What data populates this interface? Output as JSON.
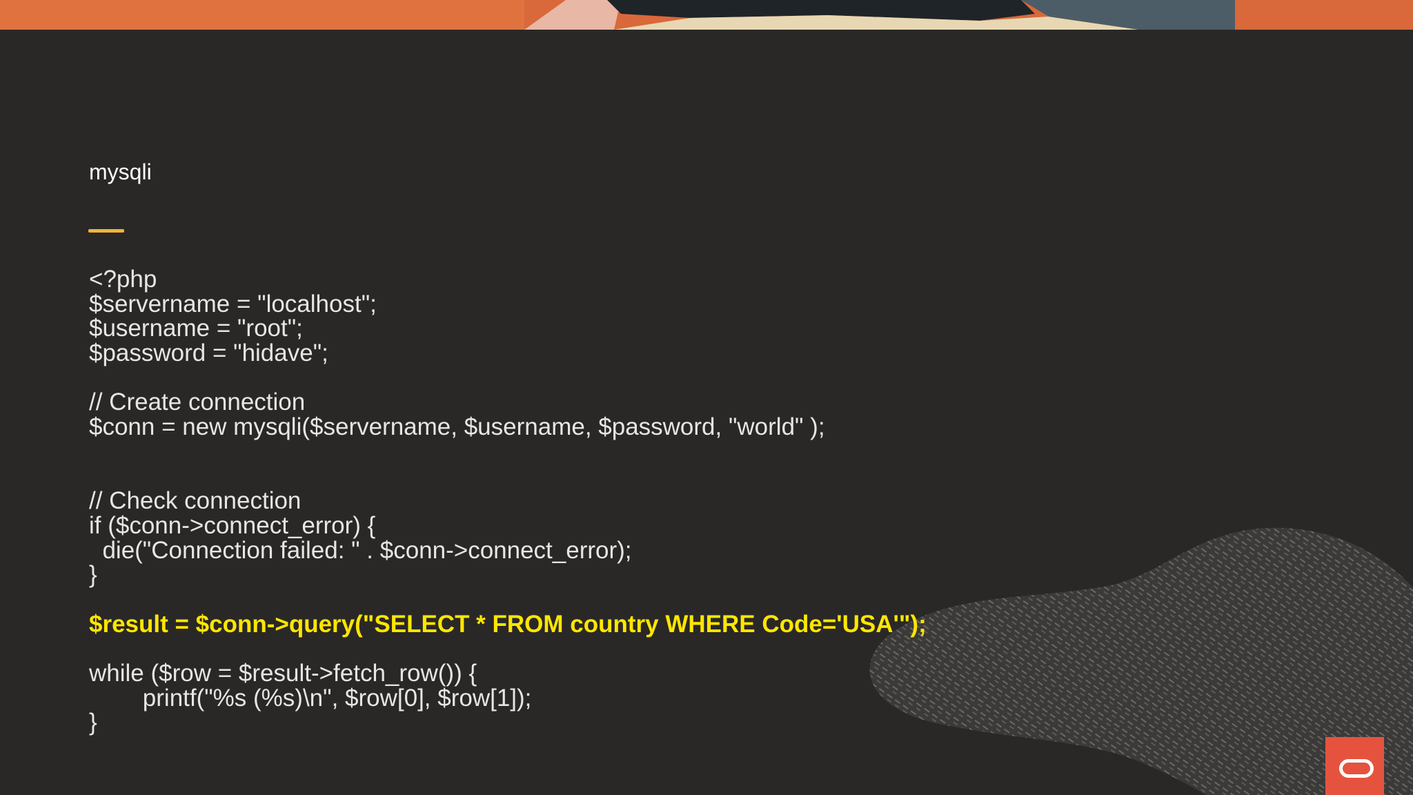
{
  "slide": {
    "title": "mysqli",
    "code_lines": [
      {
        "text": "<?php",
        "highlight": false
      },
      {
        "text": "$servername = \"localhost\";",
        "highlight": false
      },
      {
        "text": "$username = \"root\";",
        "highlight": false
      },
      {
        "text": "$password = \"hidave\";",
        "highlight": false
      },
      {
        "text": "",
        "highlight": false
      },
      {
        "text": "// Create connection",
        "highlight": false
      },
      {
        "text": "$conn = new mysqli($servername, $username, $password, \"world\" );",
        "highlight": false
      },
      {
        "text": "",
        "highlight": false
      },
      {
        "text": "",
        "highlight": false
      },
      {
        "text": "// Check connection",
        "highlight": false
      },
      {
        "text": "if ($conn->connect_error) {",
        "highlight": false
      },
      {
        "text": "  die(\"Connection failed: \" . $conn->connect_error);",
        "highlight": false
      },
      {
        "text": "}",
        "highlight": false
      },
      {
        "text": "",
        "highlight": false
      },
      {
        "text": "$result = $conn->query(\"SELECT * FROM country WHERE Code='USA'\");",
        "highlight": true
      },
      {
        "text": "",
        "highlight": false
      },
      {
        "text": "while ($row = $result->fetch_row()) {",
        "highlight": false
      },
      {
        "text": "        printf(\"%s (%s)\\n\", $row[0], $row[1]);",
        "highlight": false
      },
      {
        "text": "}",
        "highlight": false
      }
    ]
  },
  "icons": {
    "logo": "oracle-logo-icon"
  },
  "colors": {
    "background": "#2a2826",
    "accent": "#f2b33d",
    "highlight_text": "#ffe600",
    "logo_red": "#e5533f"
  }
}
